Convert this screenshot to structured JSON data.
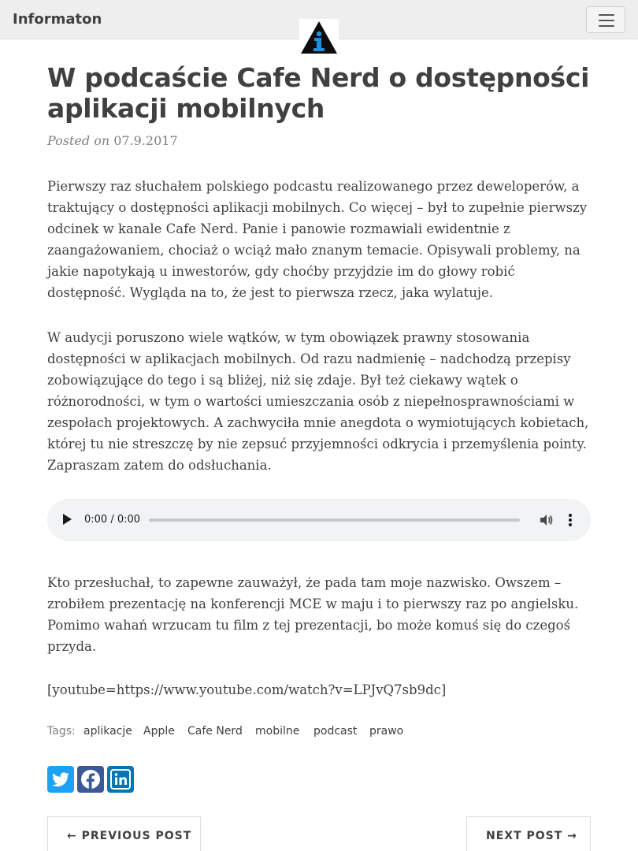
{
  "navbar": {
    "brand": "Informaton",
    "menu_icon": "hamburger-menu-icon",
    "logo_icon": "info-logo-icon",
    "logo_letter": "i"
  },
  "post": {
    "title": "W podcaście Cafe Nerd o dostępności aplikacji mobilnych",
    "posted_on_label": "Posted on",
    "date": "07.9.2017",
    "paragraphs": [
      "Pierwszy raz słuchałem polskiego podcastu realizowanego przez deweloperów, a traktujący o dostępności aplikacji mobilnych. Co więcej – był to zupełnie pierwszy odcinek w kanale Cafe Nerd. Panie i panowie rozmawiali ewidentnie z zaangażowaniem, chociaż o wciąż mało znanym temacie. Opisywali problemy, na jakie napotykają u inwestorów, gdy choćby przyjdzie im do głowy robić dostępność. Wygląda na to, że jest to pierwsza rzecz, jaka wylatuje.",
      "W audycji poruszono wiele wątków, w tym obowiązek prawny stosowania dostępności w aplikacjach mobilnych. Od razu nadmienię – nadchodzą przepisy zobowiązujące do tego i są bliżej, niż się zdaje. Był też ciekawy wątek o różnorodności, w tym o wartości umieszczania osób z niepełnosprawnościami w zespołach projektowych. A zachwyciła mnie anegdota o wymiotujących kobietach, której tu nie streszczę by nie zepsuć przyjemności odkrycia i przemyślenia pointy. Zapraszam zatem do odsłuchania.",
      "Kto przesłuchał, to zapewne zauważył, że pada tam moje nazwisko. Owszem – zrobiłem prezentację na konferencji MCE w maju i to pierwszy raz po angielsku. Pomimo wahań wrzucam tu film z tej prezentacji, bo może komuś się do czegoś przyda.",
      "[youtube=https://www.youtube.com/watch?v=LPJvQ7sb9dc]"
    ]
  },
  "audio": {
    "time": "0:00 / 0:00",
    "progress": 0,
    "play_icon": "play-icon",
    "volume_icon": "volume-icon",
    "more_icon": "more-vertical-icon"
  },
  "tags": {
    "label": "Tags:",
    "items": [
      "aplikacje",
      "Apple",
      "Cafe Nerd",
      "mobilne",
      "podcast",
      "prawo"
    ]
  },
  "social": {
    "twitter_icon": "twitter-icon",
    "facebook_icon": "facebook-icon",
    "linkedin_icon": "linkedin-icon"
  },
  "pager": {
    "previous": "← PREVIOUS POST",
    "next": "NEXT POST →"
  }
}
